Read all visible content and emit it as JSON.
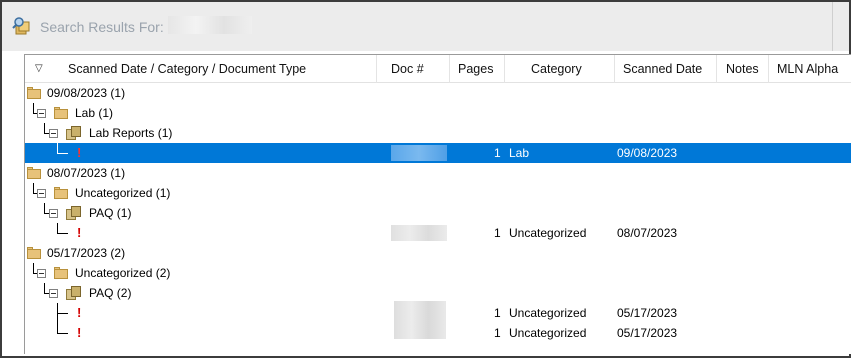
{
  "window": {
    "title": "Search Results For:",
    "icon": "search-results-icon"
  },
  "table": {
    "columns": [
      "Scanned Date / Category / Document Type",
      "Doc #",
      "Pages",
      "Category",
      "Scanned Date",
      "Notes",
      "MLN Alpha"
    ],
    "sort_icon": "sort-triangle-icon"
  },
  "tree": {
    "g1": {
      "date": "09/08/2023 (1)",
      "category": "Lab (1)",
      "doctype": "Lab Reports (1)"
    },
    "g2": {
      "date": "08/07/2023 (1)",
      "category": "Uncategorized (1)",
      "doctype": "PAQ (1)"
    },
    "g3": {
      "date": "05/17/2023 (2)",
      "category": "Uncategorized (2)",
      "doctype": "PAQ (2)"
    }
  },
  "docs": [
    {
      "mark": "!",
      "pages": "1",
      "category": "Lab",
      "scanned_date": "09/08/2023",
      "selected": true
    },
    {
      "mark": "!",
      "pages": "1",
      "category": "Uncategorized",
      "scanned_date": "08/07/2023",
      "selected": false
    },
    {
      "mark": "!",
      "pages": "1",
      "category": "Uncategorized",
      "scanned_date": "05/17/2023",
      "selected": false
    },
    {
      "mark": "!",
      "pages": "1",
      "category": "Uncategorized",
      "scanned_date": "05/17/2023",
      "selected": false
    }
  ],
  "colors": {
    "selection": "#0078d7",
    "alert": "#d40000",
    "folder": "#e7c27a"
  }
}
